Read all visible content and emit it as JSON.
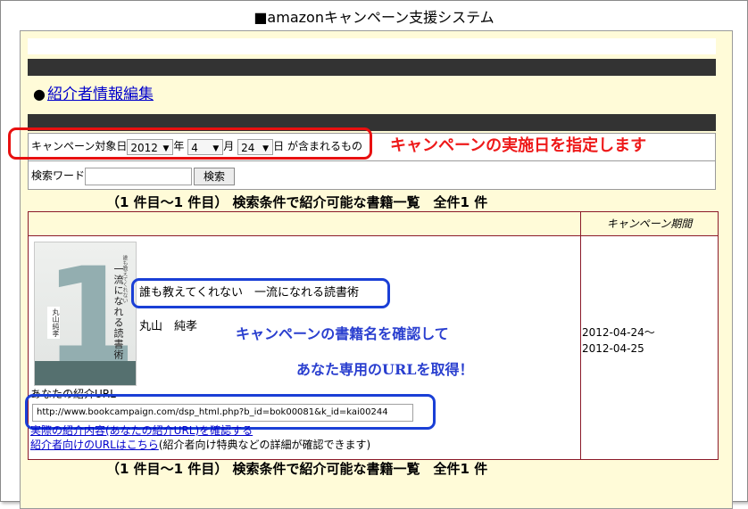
{
  "page_title": "■amazonキャンペーン支援システム",
  "section": {
    "bullet": "●",
    "link_label": "紹介者情報編集"
  },
  "search": {
    "date_prefix": "キャンペーン対象日",
    "year_value": "2012",
    "year_suffix": "年",
    "month_value": "4",
    "month_suffix": "月",
    "day_value": "24",
    "day_suffix": "日",
    "date_condition": "が含まれるもの",
    "keyword_label": "検索ワード",
    "keyword_value": "",
    "search_button": "検索"
  },
  "annotations": {
    "red_note": "キャンペーンの実施日を指定します",
    "blue_note_1": "キャンペーンの書籍名を確認して",
    "blue_note_2": "あなた専用のURLを取得！"
  },
  "results": {
    "summary": "（1 件目～1 件目） 検索条件で紹介可能な書籍一覧　全件1 件",
    "header_period": "キャンペーン期間",
    "items": [
      {
        "cover": {
          "numeral": "1",
          "title_vertical": "一流になれる読書術",
          "author_vertical": "丸山純孝",
          "sub_vertical": "誰も教えてくれない"
        },
        "title": "誰も教えてくれない　一流になれる読書術",
        "author": "丸山　純孝",
        "url_label": "あなたの紹介URL",
        "url_value": "http://www.bookcampaign.com/dsp_html.php?b_id=bok00081&k_id=kai00244",
        "link_check": "実際の紹介内容(あなたの紹介URL)を確認する",
        "link_intro_prefix": "紹介者向けのURLはこちら",
        "link_intro_suffix": "(紹介者向け特典などの詳細が確認できます)",
        "period_start": "2012-04-24～",
        "period_end": "2012-04-25"
      }
    ]
  },
  "colors": {
    "page_bg": "#fffbd8",
    "dark_bar": "#333333",
    "red_callout": "#e81010",
    "blue_callout": "#1a3fd6",
    "table_border": "#8b1a2a",
    "link": "#0000cc"
  }
}
